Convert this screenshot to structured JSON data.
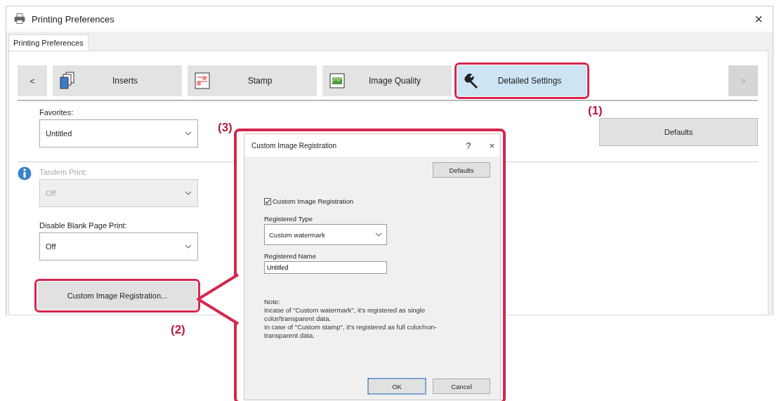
{
  "window": {
    "title": "Printing Preferences",
    "close": "×"
  },
  "sheet_tabs": [
    {
      "label": "Printing Preferences",
      "selected": true
    }
  ],
  "nav": {
    "prev": "<",
    "next": ">",
    "next_disabled": true,
    "items": [
      {
        "label": "Inserts",
        "kind": "inserts",
        "selected": false
      },
      {
        "label": "Stamp",
        "kind": "stamp",
        "selected": false
      },
      {
        "label": "Image Quality",
        "kind": "quality",
        "selected": false
      },
      {
        "label": "Detailed Settings",
        "kind": "detailed",
        "selected": true
      }
    ]
  },
  "favorites": {
    "label": "Favorites:",
    "value": "Untitled"
  },
  "defaults_button": "Defaults",
  "settings": [
    {
      "label": "Tandem Print:",
      "value": "Off",
      "disabled": true,
      "info": true
    },
    {
      "label": "Disable Blank Page Print:",
      "value": "Off",
      "disabled": false,
      "info": false
    }
  ],
  "custom_image_button": "Custom Image Registration...",
  "dialog": {
    "title": "Custom Image Registration",
    "help": "?",
    "close": "×",
    "defaults_button": "Defaults",
    "checkbox": {
      "label": "Custom Image Registration",
      "checked": true
    },
    "type": {
      "label": "Registered Type",
      "value": "Custom watermark"
    },
    "name": {
      "label": "Registered Name",
      "value": "Untitled"
    },
    "note": [
      "Note:",
      "Incase of \"Custom watermark\", it's registered as single color/transparent data.",
      "In case of \"Custom stamp\", it's registered as full color/non-transparent data."
    ],
    "buttons": [
      {
        "label": "OK",
        "default": true
      },
      {
        "label": "Cancel",
        "default": false
      }
    ]
  },
  "callouts": [
    {
      "label": "(1)"
    },
    {
      "label": "(2)"
    },
    {
      "label": "(3)"
    }
  ]
}
